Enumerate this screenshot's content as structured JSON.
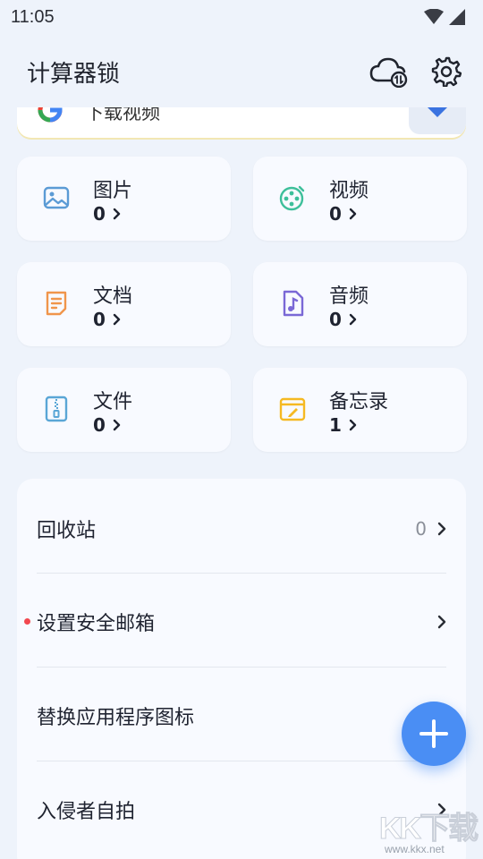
{
  "status_bar": {
    "time": "11:05"
  },
  "app_bar": {
    "title": "计算器锁",
    "cloud_icon": "cloud-sync-icon",
    "settings_icon": "gear-icon"
  },
  "banner": {
    "text": "下载视频",
    "logo": "google-icon",
    "action_icon": "download-arrow-icon"
  },
  "categories": [
    {
      "label": "图片",
      "count": "0",
      "icon": "image-icon",
      "color": "#5b9bd5"
    },
    {
      "label": "视频",
      "count": "0",
      "icon": "film-reel-icon",
      "color": "#3dbf9a"
    },
    {
      "label": "文档",
      "count": "0",
      "icon": "document-icon",
      "color": "#f0954b"
    },
    {
      "label": "音频",
      "count": "0",
      "icon": "music-note-icon",
      "color": "#7a68d6"
    },
    {
      "label": "文件",
      "count": "0",
      "icon": "zip-file-icon",
      "color": "#5aa6d6"
    },
    {
      "label": "备忘录",
      "count": "1",
      "icon": "note-edit-icon",
      "color": "#f5b922"
    }
  ],
  "settings_list": [
    {
      "label": "回收站",
      "value": "0",
      "has_dot": false
    },
    {
      "label": "设置安全邮箱",
      "value": "",
      "has_dot": true
    },
    {
      "label": "替换应用程序图标",
      "value": "",
      "has_dot": false
    },
    {
      "label": "入侵者自拍",
      "value": "",
      "has_dot": false
    }
  ],
  "fab": {
    "icon": "plus-icon",
    "color": "#4a8ef4"
  },
  "watermark": {
    "main": "KK下载",
    "sub": "www.kkx.net"
  }
}
